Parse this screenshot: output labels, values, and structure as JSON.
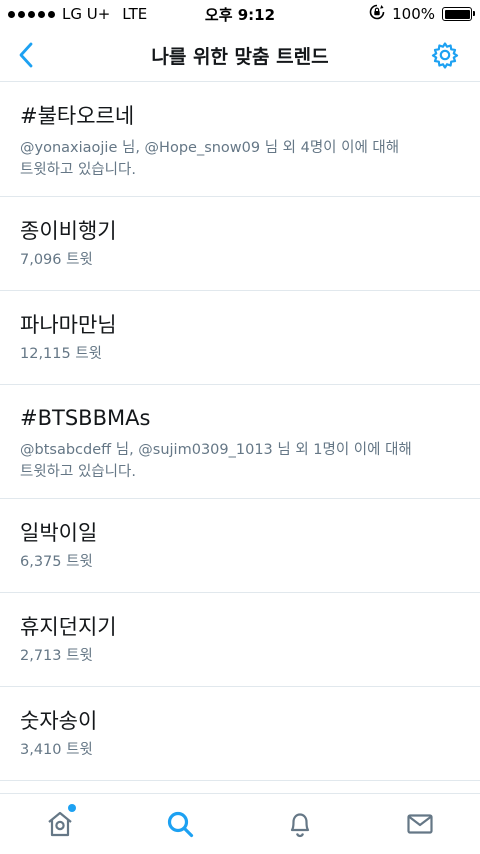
{
  "status_bar": {
    "carrier": "LG U+",
    "network": "LTE",
    "time": "오후 9:12",
    "battery": "100%",
    "battery_level": 1.0
  },
  "nav": {
    "title": "나를 위한 맞춤 트렌드",
    "back_icon": "chevron-left-icon",
    "settings_icon": "gear-icon",
    "accent_color": "#1da1f2"
  },
  "trends": [
    {
      "title": "#불타오르네",
      "subtitle": "@yonaxiaojie 님, @Hope_snow09 님 외 4명이 이에 대해",
      "subtitle2": "트윗하고 있습니다."
    },
    {
      "title": "종이비행기",
      "subtitle": "7,096 트윗"
    },
    {
      "title": "파나마만님",
      "subtitle": "12,115 트윗"
    },
    {
      "title": "#BTSBBMAs",
      "subtitle": "@btsabcdeff 님, @sujim0309_1013 님 외 1명이 이에 대해",
      "subtitle2": "트윗하고 있습니다."
    },
    {
      "title": "일박이일",
      "subtitle": "6,375 트윗"
    },
    {
      "title": "휴지던지기",
      "subtitle": "2,713 트윗"
    },
    {
      "title": "숫자송이",
      "subtitle": "3,410 트윗"
    }
  ],
  "tab_bar": {
    "tabs": [
      {
        "name": "home",
        "icon": "home-icon",
        "active": false,
        "badge": true
      },
      {
        "name": "search",
        "icon": "search-icon",
        "active": true,
        "badge": false
      },
      {
        "name": "notifications",
        "icon": "bell-icon",
        "active": false,
        "badge": false
      },
      {
        "name": "messages",
        "icon": "mail-icon",
        "active": false,
        "badge": false
      }
    ],
    "active_color": "#1da1f2",
    "inactive_color": "#657786"
  }
}
